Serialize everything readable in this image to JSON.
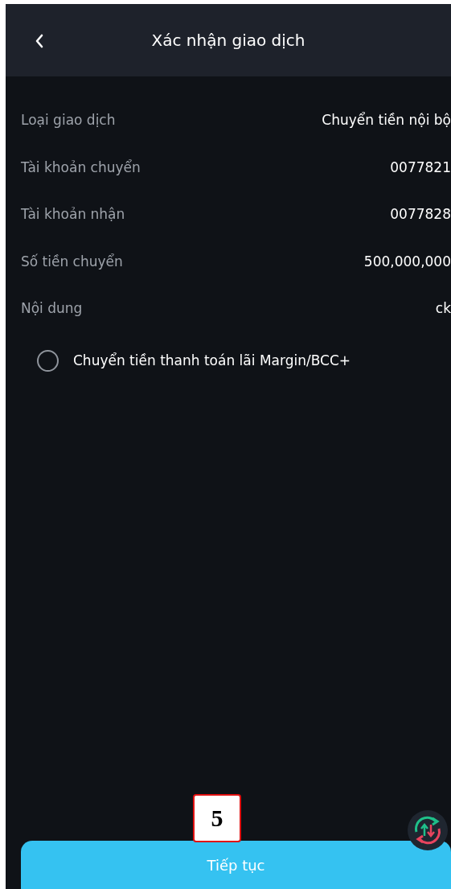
{
  "header": {
    "title": "Xác nhận giao dịch"
  },
  "details": [
    {
      "label": "Loại giao dịch",
      "value": "Chuyển tiền nội bộ"
    },
    {
      "label": "Tài khoản chuyển",
      "value": "0077821"
    },
    {
      "label": "Tài khoản nhận",
      "value": "0077828"
    },
    {
      "label": "Số tiền chuyển",
      "value": "500,000,000"
    },
    {
      "label": "Nội dung",
      "value": "ck"
    }
  ],
  "option": {
    "label": "Chuyển tiền thanh toán lãi Margin/BCC+",
    "selected": false
  },
  "step_marker": "5",
  "continue_button": "Tiếp tục"
}
